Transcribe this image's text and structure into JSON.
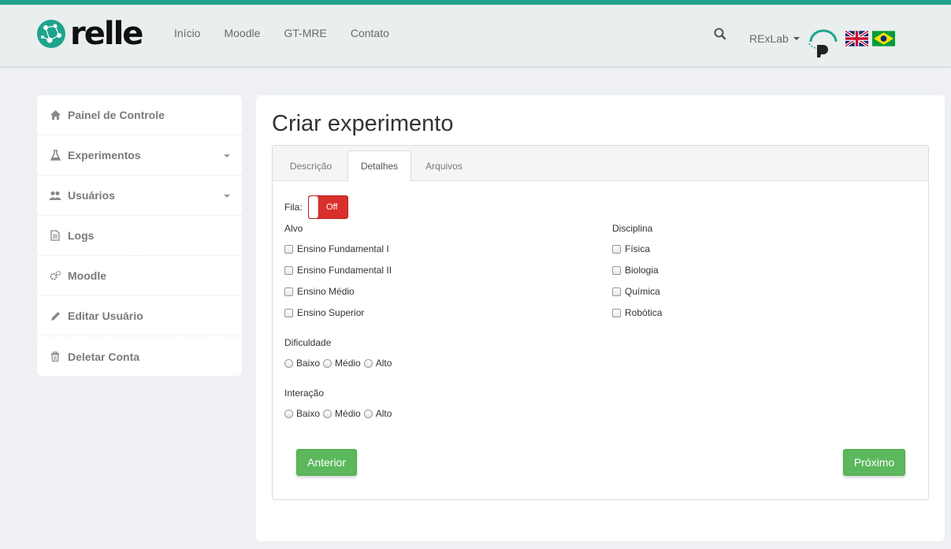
{
  "brand": {
    "name": "relle"
  },
  "nav": {
    "items": [
      "Início",
      "Moodle",
      "GT-MRE",
      "Contato"
    ]
  },
  "user": {
    "name": "RExLab"
  },
  "sidebar": {
    "items": [
      {
        "label": "Painel de Controle",
        "icon": "home-icon"
      },
      {
        "label": "Experimentos",
        "icon": "flask-icon",
        "dropdown": true
      },
      {
        "label": "Usuários",
        "icon": "users-icon",
        "dropdown": true
      },
      {
        "label": "Logs",
        "icon": "file-icon"
      },
      {
        "label": "Moodle",
        "icon": "gears-icon"
      },
      {
        "label": "Editar Usuário",
        "icon": "pencil-icon"
      },
      {
        "label": "Deletar Conta",
        "icon": "trash-icon"
      }
    ]
  },
  "page": {
    "title": "Criar experimento"
  },
  "tabs": [
    {
      "label": "Descrição",
      "active": false
    },
    {
      "label": "Detalhes",
      "active": true
    },
    {
      "label": "Arquivos",
      "active": false
    }
  ],
  "form": {
    "fila_label": "Fila:",
    "fila_toggle": "Off",
    "alvo": {
      "label": "Alvo",
      "options": [
        "Ensino Fundamental I",
        "Ensino Fundamental II",
        "Ensino Médio",
        "Ensino Superior"
      ]
    },
    "disciplina": {
      "label": "Disciplina",
      "options": [
        "Física",
        "Biologia",
        "Química",
        "Robótica"
      ]
    },
    "dificuldade": {
      "label": "Dificuldade",
      "options": [
        "Baixo",
        "Médio",
        "Alto"
      ]
    },
    "interacao": {
      "label": "Interação",
      "options": [
        "Baixo",
        "Médio",
        "Alto"
      ]
    },
    "prev_label": "Anterior",
    "next_label": "Próximo"
  },
  "colors": {
    "accent": "#1fa38d",
    "toggle_off": "#d9302c",
    "button": "#5cb85c"
  }
}
